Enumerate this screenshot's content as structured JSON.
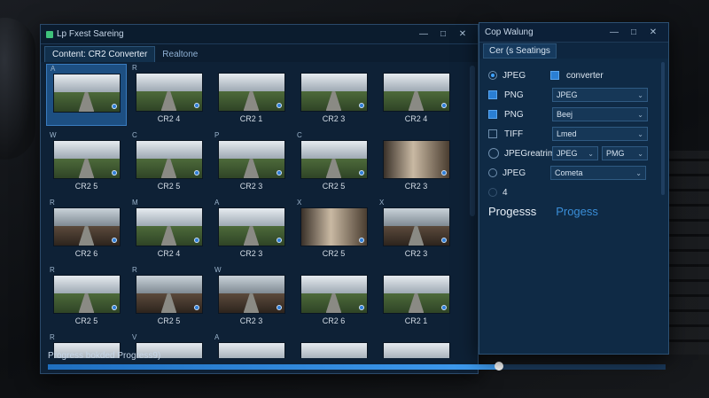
{
  "main_window": {
    "title": "Lp Fxest Sareing",
    "controls": [
      "—",
      "□",
      "✕"
    ],
    "tabs": [
      "Content: CR2 Converter",
      "Realtone"
    ],
    "thumbnails": [
      {
        "corner": "A",
        "caption": "",
        "style": "road",
        "selected": true
      },
      {
        "corner": "R",
        "caption": "CR2 4",
        "style": "road"
      },
      {
        "corner": "",
        "caption": "CR2 1",
        "style": "road"
      },
      {
        "corner": "",
        "caption": "CR2 3",
        "style": "road"
      },
      {
        "corner": "",
        "caption": "CR2 4",
        "style": "road"
      },
      {
        "corner": "W",
        "caption": "CR2 5",
        "style": "road"
      },
      {
        "corner": "C",
        "caption": "CR2 5",
        "style": "road"
      },
      {
        "corner": "P",
        "caption": "CR2 3",
        "style": "road"
      },
      {
        "corner": "C",
        "caption": "CR2 5",
        "style": "road"
      },
      {
        "corner": "",
        "caption": "CR2 3",
        "style": "interior"
      },
      {
        "corner": "R",
        "caption": "CR2 6",
        "style": "street"
      },
      {
        "corner": "M",
        "caption": "CR2 4",
        "style": "road"
      },
      {
        "corner": "A",
        "caption": "CR2 3",
        "style": "road"
      },
      {
        "corner": "X",
        "caption": "CR2 5",
        "style": "interior"
      },
      {
        "corner": "X",
        "caption": "CR2 3",
        "style": "street"
      },
      {
        "corner": "R",
        "caption": "CR2 5",
        "style": "road"
      },
      {
        "corner": "R",
        "caption": "CR2 5",
        "style": "street"
      },
      {
        "corner": "W",
        "caption": "CR2 3",
        "style": "street"
      },
      {
        "corner": "",
        "caption": "CR2 6",
        "style": "road"
      },
      {
        "corner": "",
        "caption": "CR2 1",
        "style": "road"
      },
      {
        "corner": "R",
        "caption": "",
        "style": "road"
      },
      {
        "corner": "V",
        "caption": "",
        "style": "road"
      },
      {
        "corner": "A",
        "caption": "",
        "style": "road"
      },
      {
        "corner": "",
        "caption": "",
        "style": "road"
      },
      {
        "corner": "",
        "caption": "",
        "style": "road"
      }
    ],
    "progress_label": "Progress bokded Progress9)",
    "progress_value": 0.73
  },
  "settings_window": {
    "title": "Cop Walung",
    "controls": [
      "—",
      "□",
      "✕"
    ],
    "tab": "Cer (s Seatings",
    "options": [
      {
        "control": "radio-on",
        "label": "JPEG",
        "extra_check": true,
        "extra_label": "converter",
        "select": ""
      },
      {
        "control": "check-on",
        "label": "PNG",
        "select": "JPEG"
      },
      {
        "control": "check-on",
        "label": "PNG",
        "select": "Beej"
      },
      {
        "control": "check",
        "label": "TIFF",
        "select": "Lmed"
      },
      {
        "control": "radio-big",
        "label": "JPEGreatrim",
        "select": "JPEG",
        "select2": "PMG"
      },
      {
        "control": "radio",
        "label": "JPEG",
        "select": "Cometa"
      },
      {
        "control": "radio-dim",
        "label": "4",
        "select": ""
      }
    ],
    "progress_a": "Progesss",
    "progress_b": "Progess"
  }
}
